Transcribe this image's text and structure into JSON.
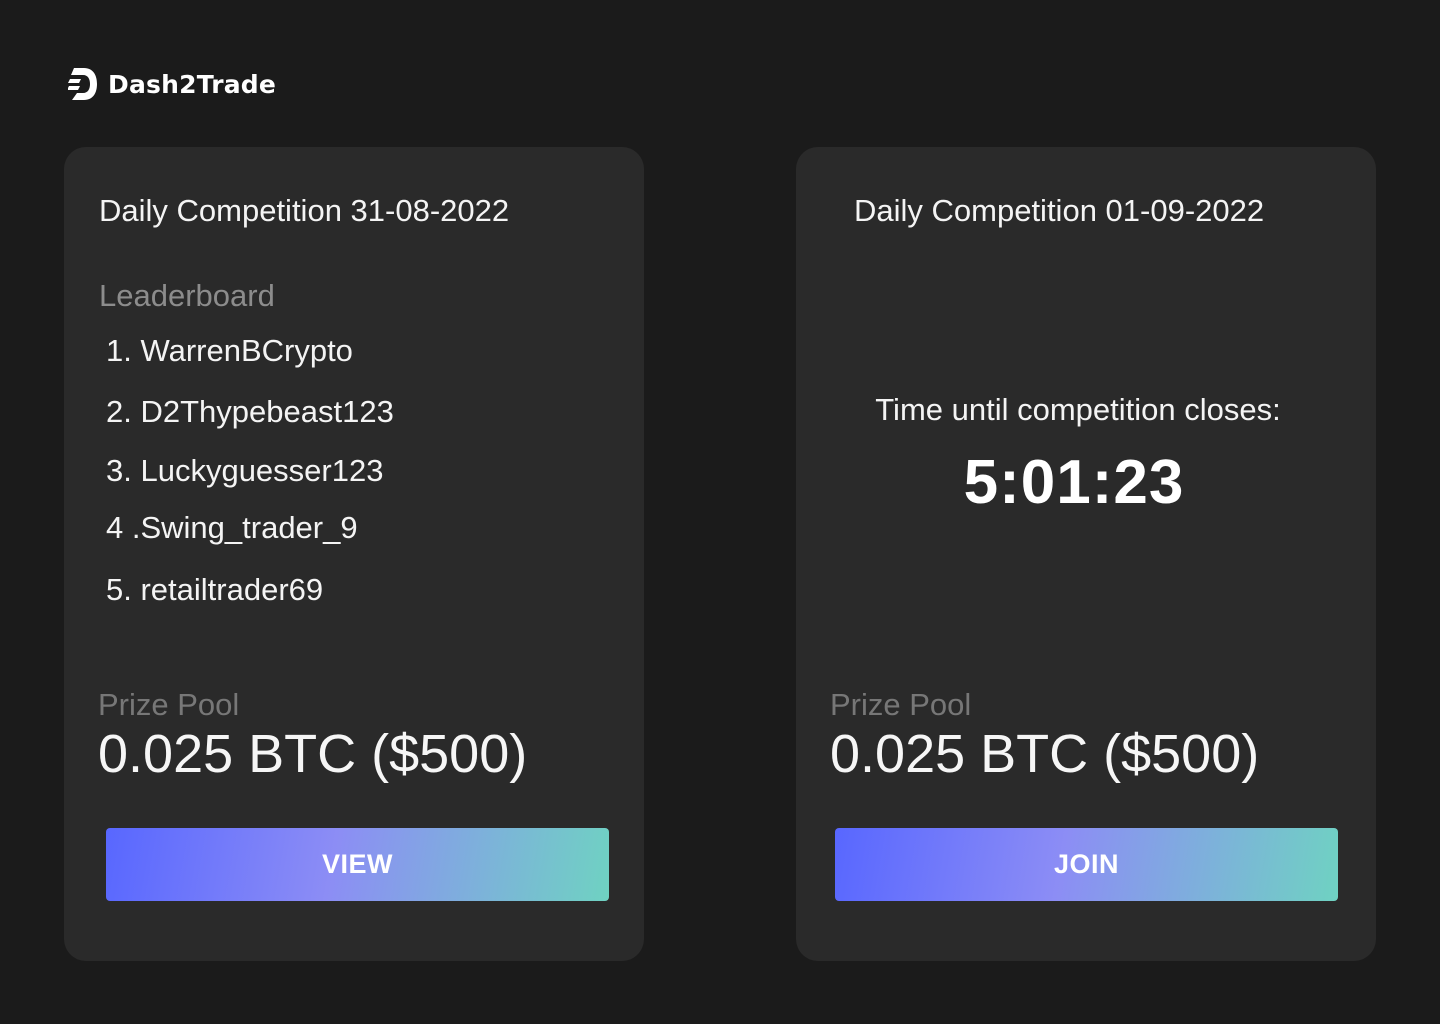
{
  "brand": {
    "name": "Dash2Trade",
    "icon": "dash2trade-logo-icon"
  },
  "competitions": {
    "past": {
      "title": "Daily Competition 31-08-2022",
      "leaderboard_heading": "Leaderboard",
      "leaderboard": [
        "1. WarrenBCrypto",
        "2. D2Thypebeast123",
        "3. Luckyguesser123",
        "4 .Swing_trader_9",
        "5. retailtrader69"
      ],
      "prize_label": "Prize Pool",
      "prize_value": "0.025 BTC ($500)",
      "button_label": "VIEW"
    },
    "current": {
      "title": "Daily Competition 01-09-2022",
      "countdown_label": "Time until competition closes:",
      "countdown_value": "5:01:23",
      "prize_label": "Prize Pool",
      "prize_value": "0.025 BTC ($500)",
      "button_label": "JOIN"
    }
  },
  "colors": {
    "background": "#1b1b1b",
    "card": "#2a2a2a",
    "button_gradient_start": "#5867ff",
    "button_gradient_mid": "#8c8df5",
    "button_gradient_end": "#6fd2c2",
    "muted_text": "#8c8c8c"
  }
}
